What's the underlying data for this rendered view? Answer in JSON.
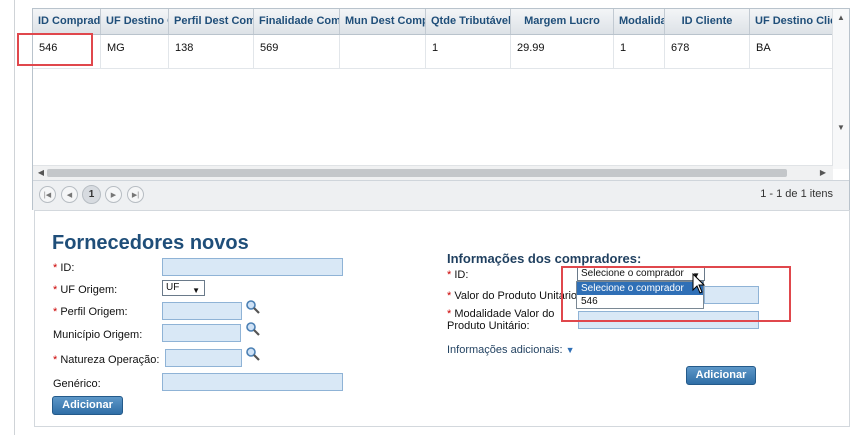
{
  "grid": {
    "columns": [
      "ID Comprador",
      "UF Destino Cliente",
      "Perfil Dest Comprador",
      "Finalidade Compra",
      "Mun Dest Compra",
      "Qtde Tributável",
      "Margem Lucro",
      "Modalidade",
      "ID Cliente",
      "UF Destino Cliente"
    ],
    "row": [
      "546",
      "MG",
      "138",
      "569",
      "",
      "1",
      "29.99",
      "1",
      "678",
      "BA"
    ],
    "pager": {
      "current_page": "1",
      "info": "1 - 1 de 1 itens"
    }
  },
  "form": {
    "title": "Fornecedores novos",
    "left": {
      "id_label": "ID:",
      "uf_label": "UF Origem:",
      "uf_value": "UF",
      "perfil_label": "Perfil Origem:",
      "municipio_label": "Município Origem:",
      "natureza_label": "Natureza Operação:",
      "generico_label": "Genérico:",
      "add_label": "Adicionar"
    },
    "right": {
      "section_title": "Informações dos compradores:",
      "id_label": "ID:",
      "comprador_select": "Selecione o comprador",
      "valor_label": "Valor do Produto Unitário:",
      "modalidade_label_1": "Modalidade Valor do",
      "modalidade_label_2": "Produto Unitário:",
      "info_adicionais": "Informações adicionais:",
      "add_label": "Adicionar",
      "dropdown_options": [
        "Selecione o comprador",
        "546"
      ]
    },
    "required_mark": "*"
  },
  "colors": {
    "accent": "#1f4e79",
    "button": "#3a7ab4",
    "highlight": "#e0474c",
    "input_bg": "#d9e8f6"
  }
}
